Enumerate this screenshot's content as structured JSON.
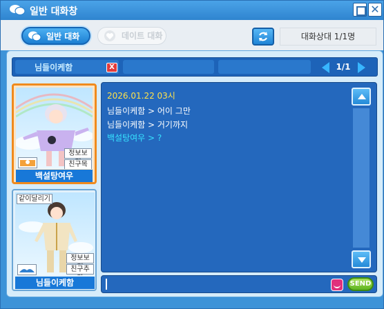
{
  "window": {
    "title": "일반 대화창",
    "icons": {
      "title": "chat-bubbles-icon",
      "maximize": "maximize-icon",
      "close": "close-icon"
    }
  },
  "toolbar": {
    "tab_general": "일반 대화",
    "tab_date": "데이트 대화",
    "refresh_icon": "refresh-icon",
    "status": "대화상대 1/1명"
  },
  "chat_tabs": {
    "active_label": "님들이케함",
    "close_label": "X",
    "page": "1/1"
  },
  "cards": {
    "me": {
      "name": "백설탕여우",
      "btn_info": "정보보기",
      "btn_friends": "친구목록"
    },
    "other": {
      "name": "님들이케함",
      "tag": "같이달리기",
      "btn_info": "정보보기",
      "btn_add": "친구추가"
    }
  },
  "chat": {
    "lines": [
      {
        "text": "2026.01.22 03시",
        "color": "#ffe14a"
      },
      {
        "text": "님들이케함 > 어이 그만",
        "color": "#ffffff"
      },
      {
        "text": "님들이케함 > 거기까지",
        "color": "#ffffff"
      },
      {
        "text": "백설탕여우 > ?",
        "color": "#36e2ff"
      }
    ]
  },
  "input": {
    "value": "",
    "send_label": "SEND",
    "emoji_icon": "emoji-icon"
  },
  "colors": {
    "accent": "#1878d8",
    "timestamp": "#ffe14a",
    "own_message": "#36e2ff",
    "selected_card_border": "#f08a1c",
    "send": "#6cc02a"
  }
}
